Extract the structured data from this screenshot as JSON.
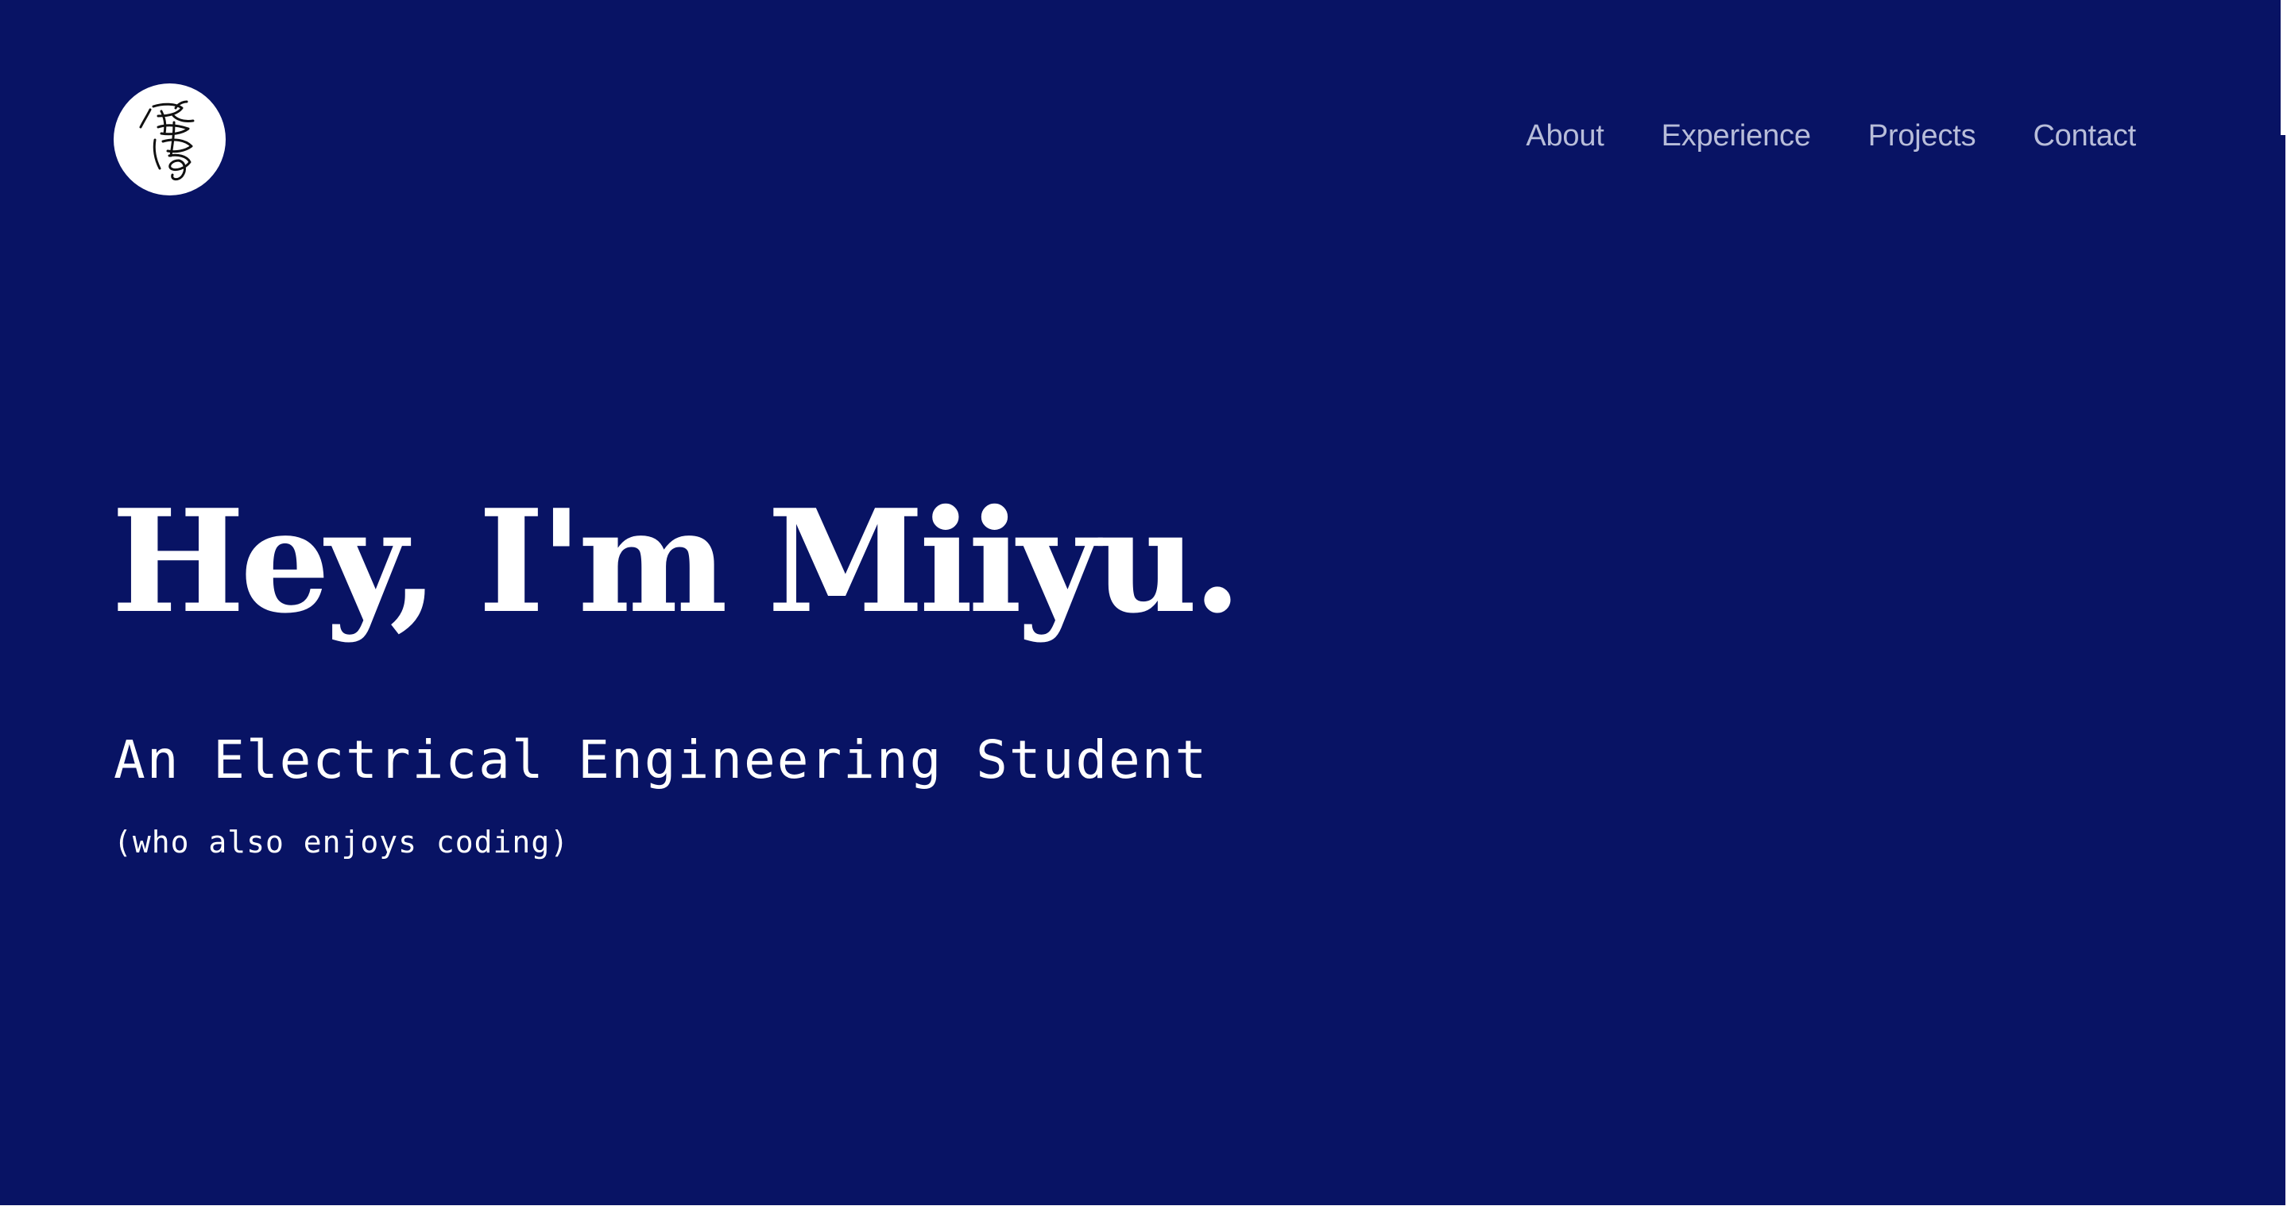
{
  "theme": {
    "background": "#081364",
    "nav_text": "#b8bdd9",
    "text": "#ffffff",
    "logo_background": "#ffffff"
  },
  "header": {
    "logo_icon": "calligraphy-signature-icon",
    "nav": [
      {
        "label": "About"
      },
      {
        "label": "Experience"
      },
      {
        "label": "Projects"
      },
      {
        "label": "Contact"
      }
    ]
  },
  "hero": {
    "title": "Hey, I'm Miiyu.",
    "subtitle": "An Electrical Engineering Student",
    "note": "(who also enjoys coding)"
  }
}
